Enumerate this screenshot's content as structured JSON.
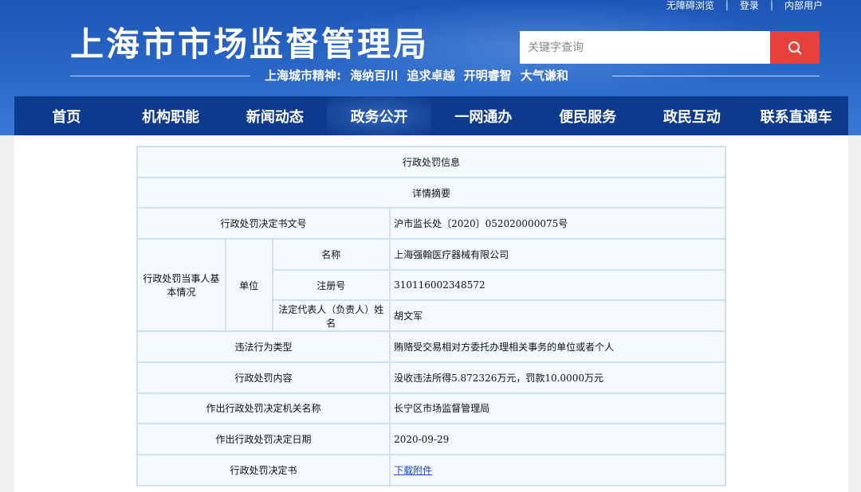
{
  "header": {
    "top_links": [
      "无障碍浏览",
      "登录",
      "内部用户"
    ],
    "title": "上海市市场监督管理局",
    "search_placeholder": "关键字查询",
    "slogan": "上海城市精神: 海纳百川 追求卓越 开明睿智 大气谦和"
  },
  "nav": {
    "items": [
      "首页",
      "机构职能",
      "新闻动态",
      "政务公开",
      "一网通办",
      "便民服务",
      "政民互动",
      "联系直通车"
    ],
    "active_index": 3
  },
  "record": {
    "title": "行政处罚信息",
    "subtitle": "详情摘要",
    "decision_no_label": "行政处罚决定书文号",
    "decision_no": "沪市监长处〔2020〕052020000075号",
    "party_label": "行政处罚当事人基本情况",
    "unit_label": "单位",
    "name_label": "名称",
    "name": "上海强翰医疗器械有限公司",
    "reg_no_label": "注册号",
    "reg_no": "310116002348572",
    "legal_rep_label": "法定代表人（负责人）姓名",
    "legal_rep": "胡文军",
    "violation_type_label": "违法行为类型",
    "violation_type": "贿赂受交易相对方委托办理相关事务的单位或者个人",
    "penalty_content_label": "行政处罚内容",
    "penalty_content": "没收违法所得5.872326万元，罚款10.0000万元",
    "authority_label": "作出行政处罚决定机关名称",
    "authority": "长宁区市场监督管理局",
    "date_label": "作出行政处罚决定日期",
    "date": "2020-09-29",
    "document_label": "行政处罚决定书",
    "document_link": "下载附件"
  },
  "colors": {
    "header_blue": "#2a68c8",
    "nav_blue": "#0e3a8e",
    "search_red": "#e5403a",
    "table_border": "#cfe0f0",
    "link_blue": "#1a4ad0"
  }
}
